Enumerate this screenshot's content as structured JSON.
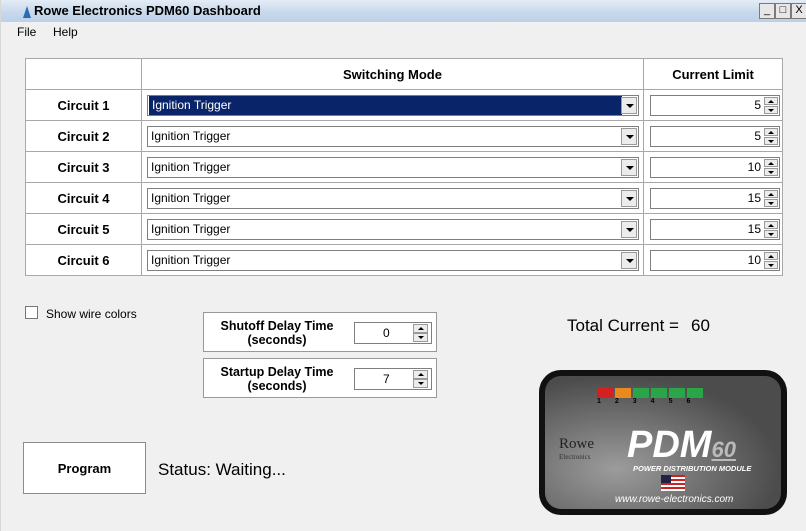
{
  "window": {
    "title": "Rowe Electronics PDM60 Dashboard",
    "controls": [
      "_",
      "□",
      "X"
    ]
  },
  "menu": {
    "file": "File",
    "help": "Help"
  },
  "table": {
    "headers": {
      "mode": "Switching Mode",
      "limit": "Current Limit"
    },
    "rows": [
      {
        "label": "Circuit 1",
        "mode": "Ignition Trigger",
        "limit": "5",
        "selected": true
      },
      {
        "label": "Circuit 2",
        "mode": "Ignition Trigger",
        "limit": "5"
      },
      {
        "label": "Circuit 3",
        "mode": "Ignition Trigger",
        "limit": "10"
      },
      {
        "label": "Circuit 4",
        "mode": "Ignition Trigger",
        "limit": "15"
      },
      {
        "label": "Circuit 5",
        "mode": "Ignition Trigger",
        "limit": "15"
      },
      {
        "label": "Circuit 6",
        "mode": "Ignition Trigger",
        "limit": "10"
      }
    ]
  },
  "options": {
    "show_wire_colors": "Show wire colors",
    "show_wire_colors_checked": false
  },
  "delays": {
    "shutoff": {
      "label_line1": "Shutoff Delay Time",
      "label_line2": "(seconds)",
      "value": "0"
    },
    "startup": {
      "label_line1": "Startup Delay Time",
      "label_line2": "(seconds)",
      "value": "7"
    }
  },
  "total": {
    "label": "Total Current =",
    "value": "60"
  },
  "program_button": "Program",
  "status": "Status: Waiting...",
  "logo": {
    "led_colors": [
      "#d42020",
      "#e88a1e",
      "#2aa54a",
      "#2aa54a",
      "#2aa54a",
      "#2aa54a"
    ],
    "numbers": "123456",
    "brand": "Rowe",
    "brand_sub": "Electronics",
    "pdm": "PDM",
    "sixty": "60",
    "tagline": "POWER DISTRIBUTION MODULE",
    "url": "www.rowe-electronics.com"
  }
}
